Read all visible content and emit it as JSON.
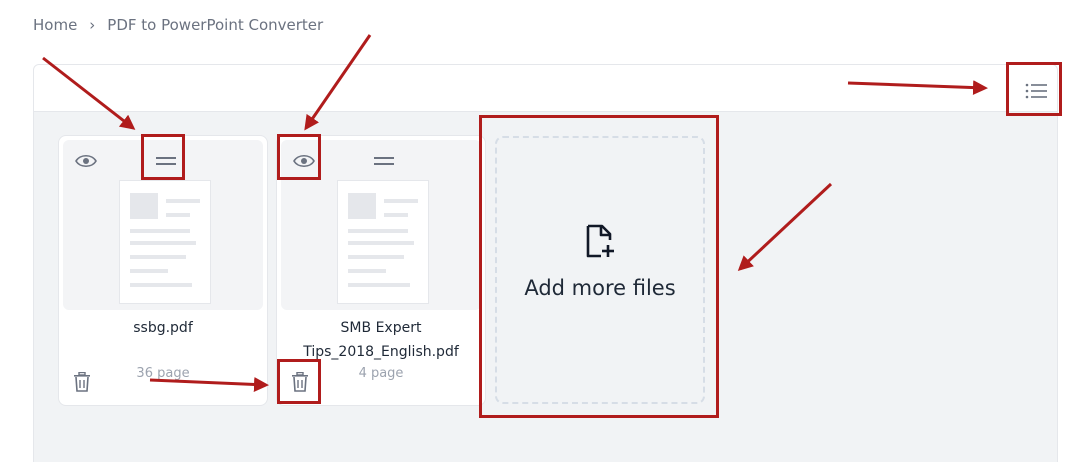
{
  "breadcrumb": {
    "home": "Home",
    "separator": "›",
    "current": "PDF to PowerPoint Converter"
  },
  "toolbar": {
    "view_toggle_icon": "list-icon"
  },
  "files": [
    {
      "name": "ssbg.pdf",
      "pages": "36 page"
    },
    {
      "name": "SMB Expert Tips_2018_English.pdf",
      "pages": "4 page"
    }
  ],
  "add_files": {
    "label": "Add more files",
    "icon": "file-plus-icon"
  },
  "annotations": {
    "color": "#b01c1c"
  }
}
